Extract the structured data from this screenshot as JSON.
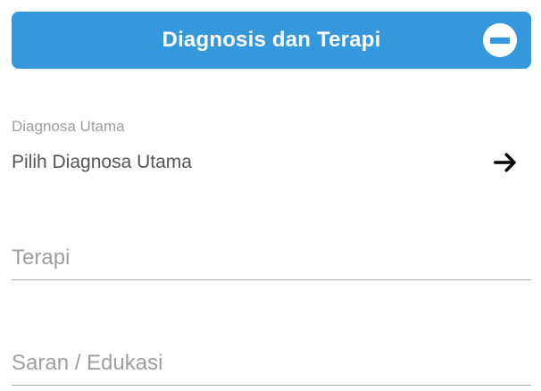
{
  "header": {
    "title": "Diagnosis dan Terapi",
    "toggle_icon": "minus-circle-icon",
    "accent_color": "#3598dc"
  },
  "diagnosa": {
    "label": "Diagnosa Utama",
    "value": "Pilih Diagnosa Utama",
    "action_icon": "arrow-right-icon"
  },
  "terapi": {
    "placeholder": "Terapi",
    "value": ""
  },
  "saran": {
    "placeholder": "Saran / Edukasi",
    "value": ""
  }
}
